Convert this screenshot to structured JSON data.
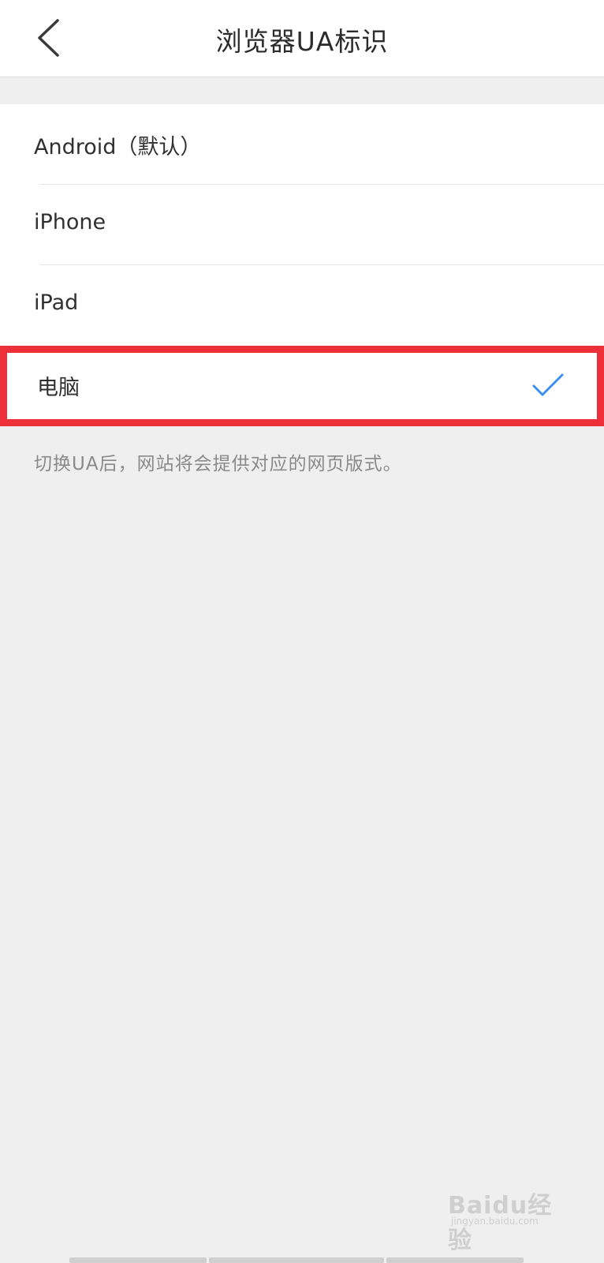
{
  "header": {
    "title": "浏览器UA标识",
    "back_icon": "chevron-left-icon"
  },
  "options": [
    {
      "label": "Android（默认）",
      "selected": false
    },
    {
      "label": "iPhone",
      "selected": false
    },
    {
      "label": "iPad",
      "selected": false
    },
    {
      "label": "电脑",
      "selected": true
    }
  ],
  "hint": "切换UA后，网站将会提供对应的网页版式。",
  "watermark": {
    "main": "Baidu经验",
    "sub": "jingyan.baidu.com"
  },
  "colors": {
    "highlight_border": "#ec2f38",
    "check": "#3c8df0",
    "background": "#efefef"
  }
}
